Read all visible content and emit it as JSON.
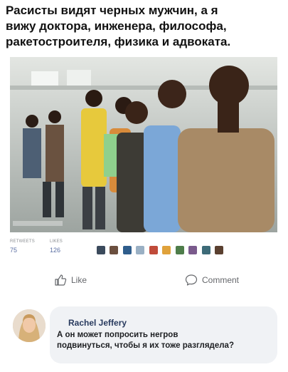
{
  "post": {
    "text": "Расисты видят черных мужчин, а я\nвижу доктора, инженера, философа,\nракетостроителя, физика и адвоката.",
    "photo_icon": "photo-of-men-standing-in-line"
  },
  "stats": {
    "first_label": "RETWEETS",
    "first_value": "75",
    "second_label": "LIKES",
    "second_value": "126"
  },
  "actions": {
    "like_label": "Like",
    "comment_label": "Comment"
  },
  "comment": {
    "author": "Rachel Jeffery",
    "text": "А он может попросить негров\nподвинуться, чтобы я их тоже разглядела?"
  },
  "colors": {
    "stat_value": "#5b6fa3",
    "bubble_bg": "#f0f2f5",
    "author_name": "#283a5e",
    "action_text": "#65676b"
  }
}
